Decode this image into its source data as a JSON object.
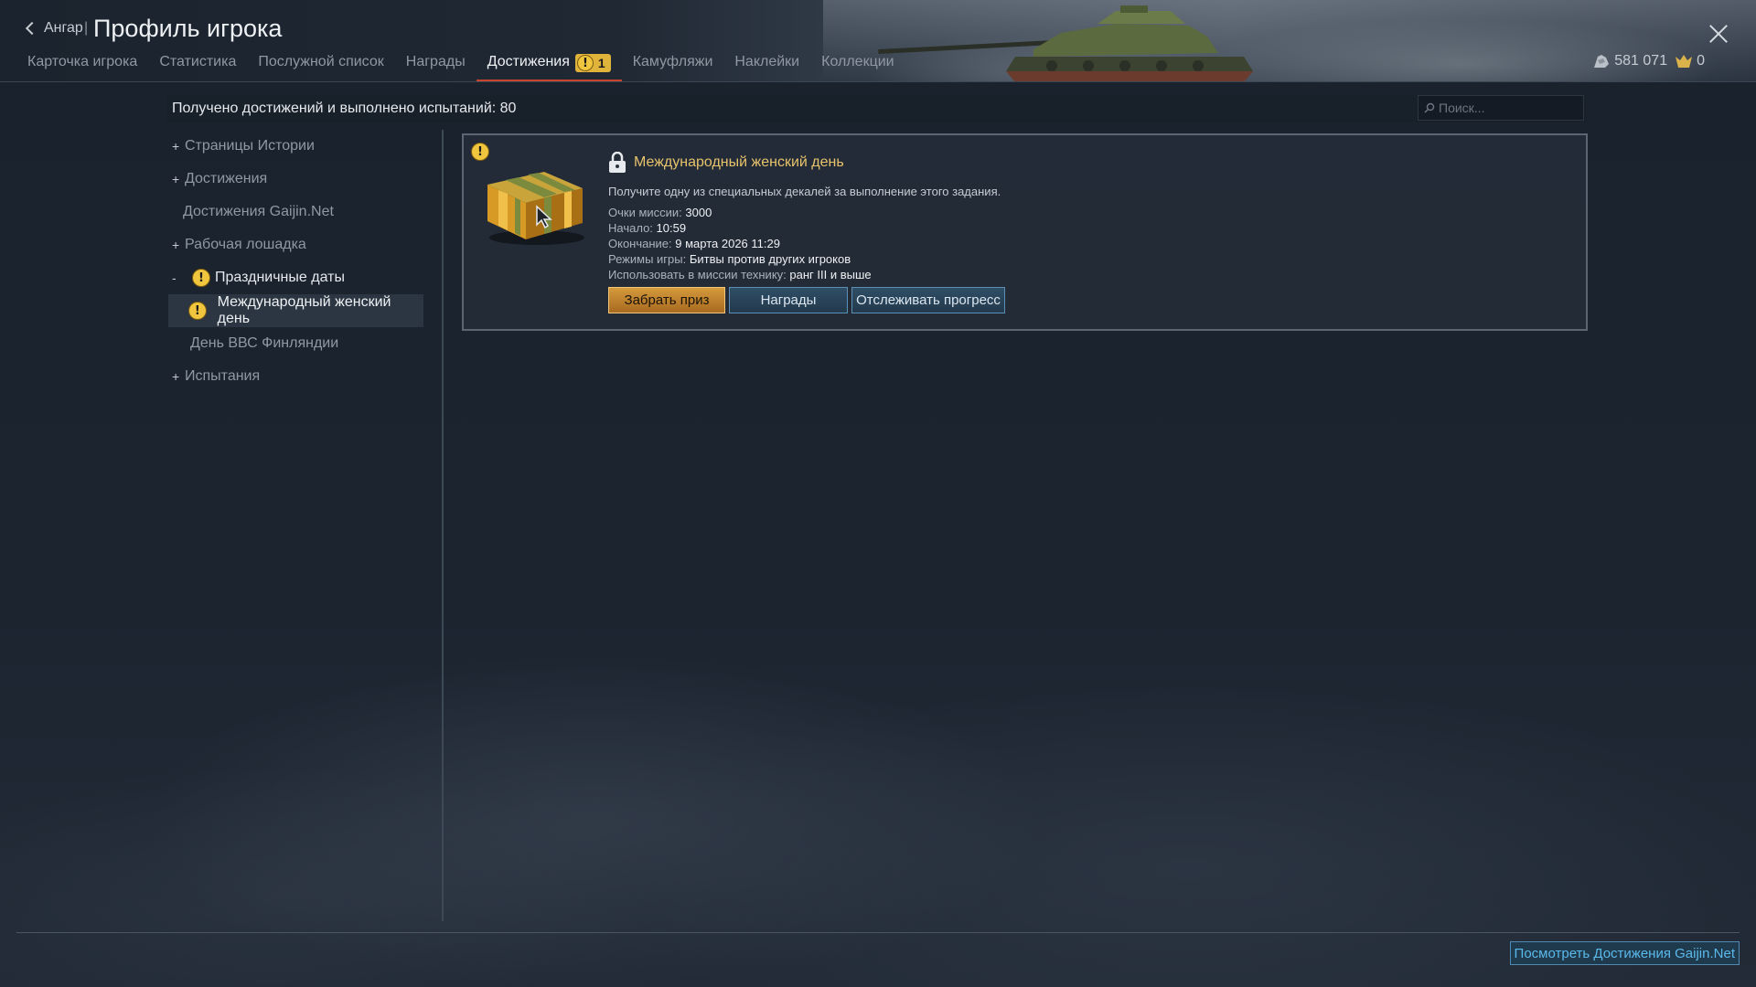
{
  "header": {
    "back_label": "Ангар",
    "separator": "|",
    "title": "Профиль игрока",
    "tabs": [
      {
        "label": "Карточка игрока"
      },
      {
        "label": "Статистика"
      },
      {
        "label": "Послужной список"
      },
      {
        "label": "Награды"
      },
      {
        "label": "Достижения",
        "badge": "1",
        "active": true
      },
      {
        "label": "Камуфляжи"
      },
      {
        "label": "Наклейки"
      },
      {
        "label": "Коллекции"
      }
    ],
    "currency": {
      "silver": "581 071",
      "eagles": "0"
    }
  },
  "summary": {
    "text": "Получено достижений и выполнено испытаний: 80",
    "search_placeholder": "Поиск..."
  },
  "sidebar": {
    "items": [
      {
        "prefix": "+",
        "label": "Страницы Истории"
      },
      {
        "prefix": "+",
        "label": "Достижения"
      },
      {
        "prefix": "",
        "label": "Достижения Gaijin.Net"
      },
      {
        "prefix": "+",
        "label": "Рабочая лошадка"
      },
      {
        "prefix": "-",
        "label": "Праздничные даты",
        "warn": true
      },
      {
        "prefix": "",
        "label": "Международный женский день",
        "warn": true,
        "selected": true
      },
      {
        "prefix": "",
        "label": "День ВВС Финляндии"
      },
      {
        "prefix": "+",
        "label": "Испытания"
      }
    ]
  },
  "card": {
    "title": "Международный женский день",
    "description": "Получите одну из специальных декалей за выполнение этого задания.",
    "details": [
      {
        "label": "Очки миссии: ",
        "value": "3000"
      },
      {
        "label": "Начало: ",
        "value": "10:59"
      },
      {
        "label": "Окончание: ",
        "value": "9 марта 2026 11:29"
      },
      {
        "label": "Режимы игры: ",
        "value": "Битвы против других игроков"
      },
      {
        "label": "Использовать в миссии технику: ",
        "value": "ранг III и выше"
      }
    ],
    "buttons": {
      "claim": "Забрать приз",
      "rewards": "Награды",
      "track": "Отслеживать прогресс"
    }
  },
  "footer": {
    "gaijin_button": "Посмотреть Достижения Gaijin.Net"
  },
  "colors": {
    "accent_tab_underline": "#c9442f",
    "title_gold": "#e8c36c",
    "warning_yellow": "#f0c63e",
    "link_blue": "#5ab9ea"
  }
}
